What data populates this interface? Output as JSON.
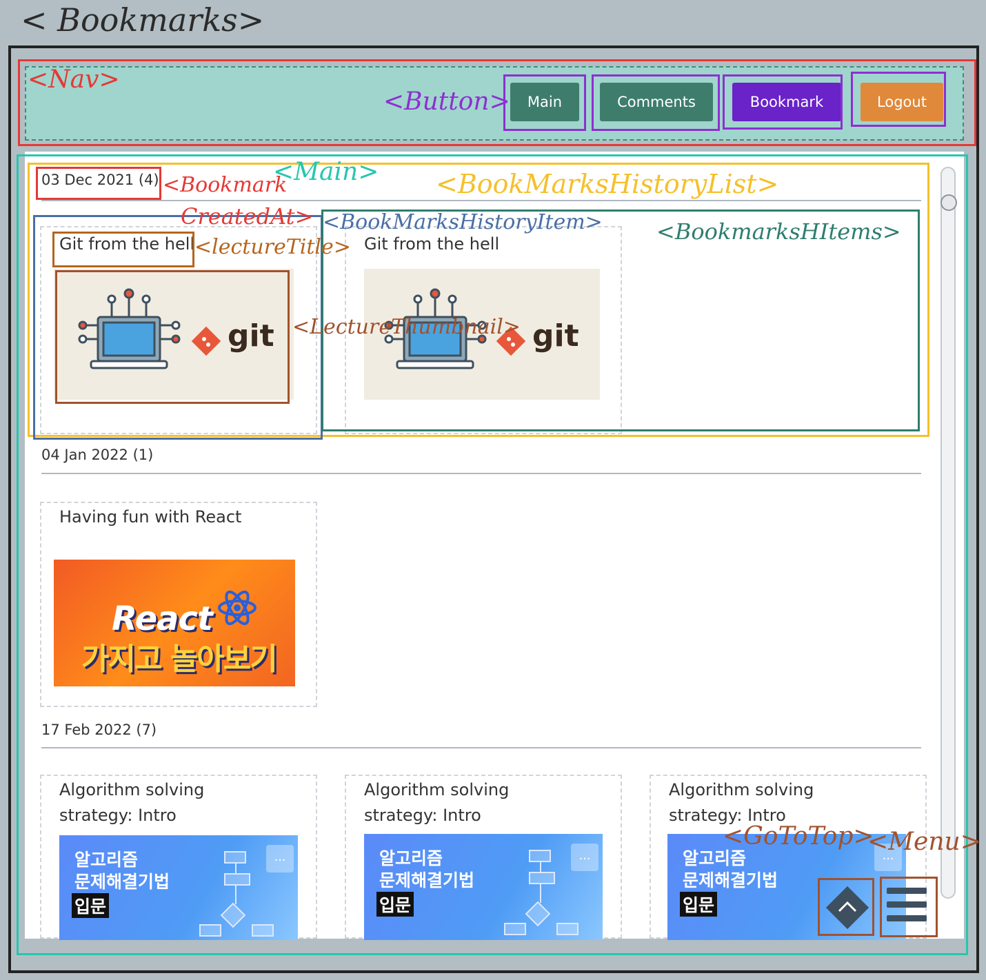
{
  "page_title": "< Bookmarks>",
  "nav": {
    "buttons": [
      {
        "label": "Main",
        "color": "#3e7d6c"
      },
      {
        "label": "Comments",
        "color": "#3e7d6c"
      },
      {
        "label": "Bookmark",
        "color": "#6a22c9"
      },
      {
        "label": "Logout",
        "color": "#e0893b"
      }
    ]
  },
  "annotations": {
    "nav": "<Nav>",
    "button": "<Button>",
    "main": "<Main>",
    "bookmark_created_at_a": "<Bookmark",
    "bookmark_created_at_b": "CreatedAt>",
    "history_list": "<BookMarksHistoryList>",
    "history_item": "<BookMarksHistoryItem>",
    "history_items": "<BookmarksHItems>",
    "lecture_title": "<lectureTitle>",
    "lecture_thumbnail": "<LectureThumbnail>",
    "go_to_top": "<GoToTop>",
    "menu": "<Menu>"
  },
  "groups": [
    {
      "date": "03 Dec 2021 (4)",
      "items": [
        {
          "title": "Git from the hell",
          "thumbnail": "git"
        },
        {
          "title": "Git from the hell",
          "thumbnail": "git"
        }
      ]
    },
    {
      "date": "04 Jan 2022 (1)",
      "items": [
        {
          "title": "Having fun with React",
          "thumbnail": "react"
        }
      ]
    },
    {
      "date": "17 Feb 2022 (7)",
      "items": [
        {
          "title": "Algorithm solving\nstrategy: Intro",
          "thumbnail": "algorithm"
        },
        {
          "title": "Algorithm solving\nstrategy: Intro",
          "thumbnail": "algorithm"
        },
        {
          "title": "Algorithm solving\nstrategy: Intro",
          "thumbnail": "algorithm"
        }
      ]
    }
  ],
  "thumb_text": {
    "git": "git",
    "react_word": "React",
    "react_sub": "가지고 놀아보기",
    "algo_line1": "알고리즘",
    "algo_line2": "문제해결기법",
    "algo_badge": "입문",
    "algo_dots": "..."
  },
  "icons": {
    "go_to_top": "chevron-up-icon",
    "menu": "hamburger-menu-icon",
    "git": "git-logo-icon",
    "react": "react-atom-icon",
    "algorithm": "flowchart-icon",
    "computer": "laptop-circuit-icon"
  },
  "colors": {
    "nav_bg": "#9fd5cd",
    "page_bg": "#b2bec3"
  }
}
